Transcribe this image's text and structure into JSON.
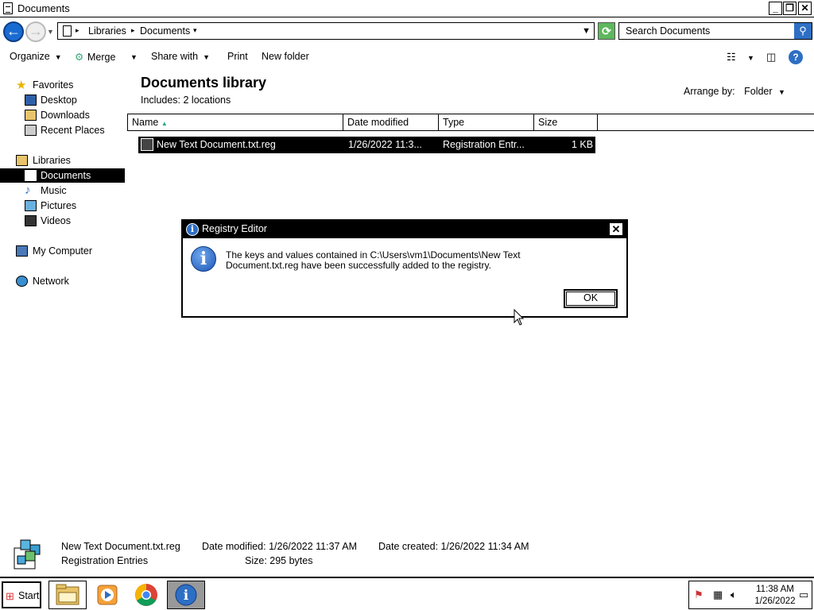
{
  "window": {
    "title": "Documents",
    "min_label": "_",
    "max_label": "❐",
    "close_label": "✕"
  },
  "address": {
    "crumbs": [
      "Libraries",
      "Documents"
    ],
    "search_placeholder": "Search Documents"
  },
  "toolbar": {
    "organize": "Organize",
    "merge": "Merge",
    "share_with": "Share with",
    "print": "Print",
    "new_folder": "New folder"
  },
  "nav": {
    "favorites": "Favorites",
    "desktop": "Desktop",
    "downloads": "Downloads",
    "recent_places": "Recent Places",
    "libraries": "Libraries",
    "documents": "Documents",
    "music": "Music",
    "pictures": "Pictures",
    "videos": "Videos",
    "my_computer": "My Computer",
    "network": "Network"
  },
  "library": {
    "title": "Documents library",
    "includes": "Includes:  2 locations",
    "arrange_label": "Arrange by:",
    "arrange_value": "Folder"
  },
  "columns": {
    "name": "Name",
    "date_modified": "Date modified",
    "type": "Type",
    "size": "Size"
  },
  "file": {
    "name": "New Text Document.txt.reg",
    "date": "1/26/2022 11:3...",
    "type": "Registration Entr...",
    "size": "1 KB"
  },
  "dialog": {
    "title": "Registry Editor",
    "message_line1": "The keys and values contained in C:\\Users\\vm1\\Documents\\New Text",
    "message_line2": "Document.txt.reg have been successfully added to the registry.",
    "ok": "OK"
  },
  "details": {
    "filename": "New Text Document.txt.reg",
    "date_modified": "Date modified: 1/26/2022 11:37 AM",
    "date_created": "Date created: 1/26/2022 11:34 AM",
    "type": "Registration Entries",
    "size": "Size: 295 bytes"
  },
  "taskbar": {
    "start": "Start",
    "time": "11:38 AM",
    "date": "1/26/2022"
  },
  "colors": {
    "selection": "#000000",
    "accent_blue": "#2d6fc4"
  }
}
